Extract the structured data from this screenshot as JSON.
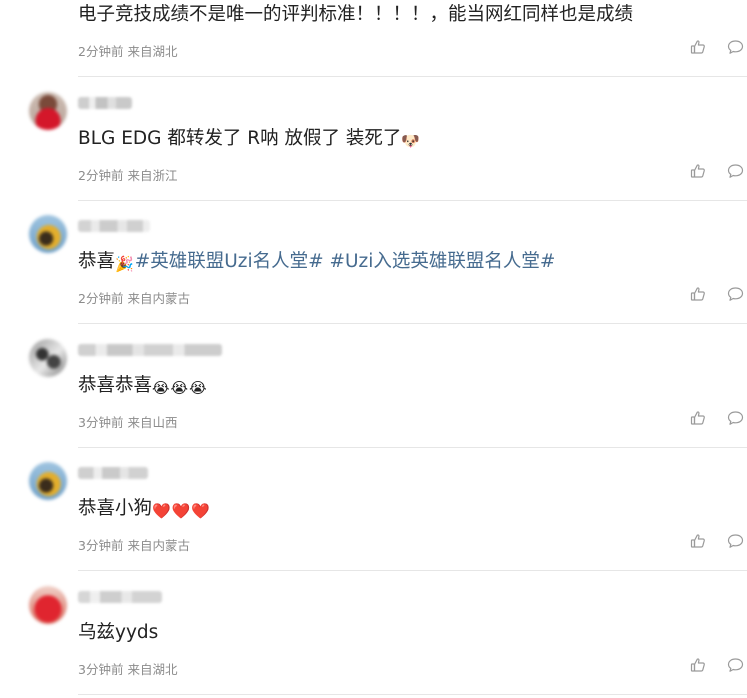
{
  "comments": [
    {
      "username": "",
      "parts": [
        {
          "kind": "text",
          "value": "电子竞技成绩不是唯一的评判标准！！！！，能当网红同样也是成绩"
        }
      ],
      "time": "2分钟前",
      "location": "来自湖北"
    },
    {
      "username": "",
      "parts": [
        {
          "kind": "text",
          "value": "BLG EDG 都转发了 R呐 放假了 装死了"
        },
        {
          "kind": "emoji",
          "value": "🐶"
        }
      ],
      "time": "2分钟前",
      "location": "来自浙江"
    },
    {
      "username": "",
      "parts": [
        {
          "kind": "text",
          "value": "恭喜"
        },
        {
          "kind": "emoji",
          "value": "🎉"
        },
        {
          "kind": "tag",
          "value": "#英雄联盟Uzi名人堂#"
        },
        {
          "kind": "text",
          "value": " "
        },
        {
          "kind": "tag",
          "value": "#Uzi入选英雄联盟名人堂#"
        }
      ],
      "time": "2分钟前",
      "location": "来自内蒙古"
    },
    {
      "username": "",
      "parts": [
        {
          "kind": "text",
          "value": "恭喜恭喜"
        },
        {
          "kind": "emoji",
          "value": "😭"
        },
        {
          "kind": "emoji",
          "value": "😭"
        },
        {
          "kind": "emoji",
          "value": "😭"
        }
      ],
      "time": "3分钟前",
      "location": "来自山西"
    },
    {
      "username": "",
      "parts": [
        {
          "kind": "text",
          "value": "恭喜小狗"
        },
        {
          "kind": "emoji",
          "value": "❤️"
        },
        {
          "kind": "emoji",
          "value": "❤️"
        },
        {
          "kind": "emoji",
          "value": "❤️"
        }
      ],
      "time": "3分钟前",
      "location": "来自内蒙古"
    },
    {
      "username": "",
      "parts": [
        {
          "kind": "text",
          "value": "乌兹yyds"
        }
      ],
      "time": "3分钟前",
      "location": "来自湖北"
    }
  ],
  "icons": {
    "like": "thumbs-up-icon",
    "reply": "comment-bubble-icon"
  },
  "colors": {
    "text": "#222222",
    "meta": "#8c8c8c",
    "hashtag": "#466b8f",
    "divider": "#e6e6e6",
    "icon": "#9a9a9a"
  }
}
